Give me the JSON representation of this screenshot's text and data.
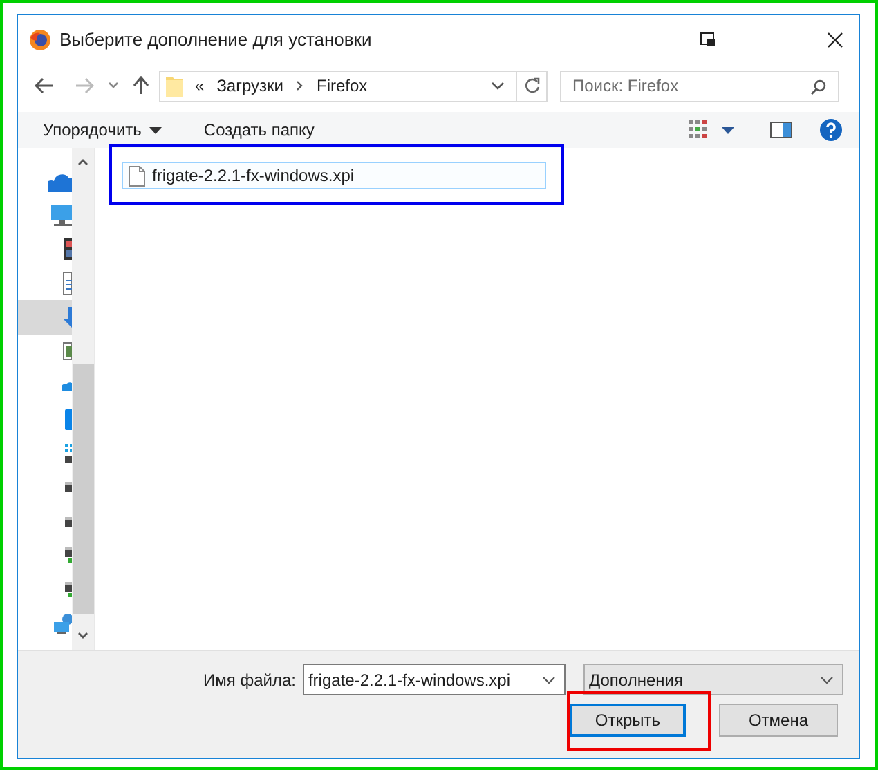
{
  "window": {
    "title": "Выберите дополнение для установки"
  },
  "address_bar": {
    "overflow": "«",
    "path": [
      "Загрузки",
      "Firefox"
    ]
  },
  "search": {
    "placeholder": "Поиск: Firefox"
  },
  "toolbar": {
    "organize": "Упорядочить",
    "new_folder": "Создать папку"
  },
  "nav_pane": [
    {
      "kind": "cloud",
      "selected": false
    },
    {
      "kind": "monitor",
      "selected": false
    },
    {
      "kind": "film",
      "selected": false
    },
    {
      "kind": "document",
      "selected": false
    },
    {
      "kind": "download",
      "selected": true
    },
    {
      "kind": "image",
      "selected": false
    },
    {
      "kind": "cloud-small",
      "selected": false
    },
    {
      "kind": "tablet",
      "selected": false
    },
    {
      "kind": "windows-drive",
      "selected": false
    },
    {
      "kind": "drive",
      "selected": false
    },
    {
      "kind": "drive",
      "selected": false
    },
    {
      "kind": "drive-green",
      "selected": false
    },
    {
      "kind": "drive-green",
      "selected": false
    },
    {
      "kind": "network",
      "selected": false
    }
  ],
  "files": [
    {
      "name": "frigate-2.2.1-fx-windows.xpi",
      "selected": true
    }
  ],
  "footer": {
    "file_name_label": "Имя файла:",
    "file_name": "frigate-2.2.1-fx-windows.xpi",
    "filter": "Дополнения",
    "open": "Открыть",
    "cancel": "Отмена"
  }
}
